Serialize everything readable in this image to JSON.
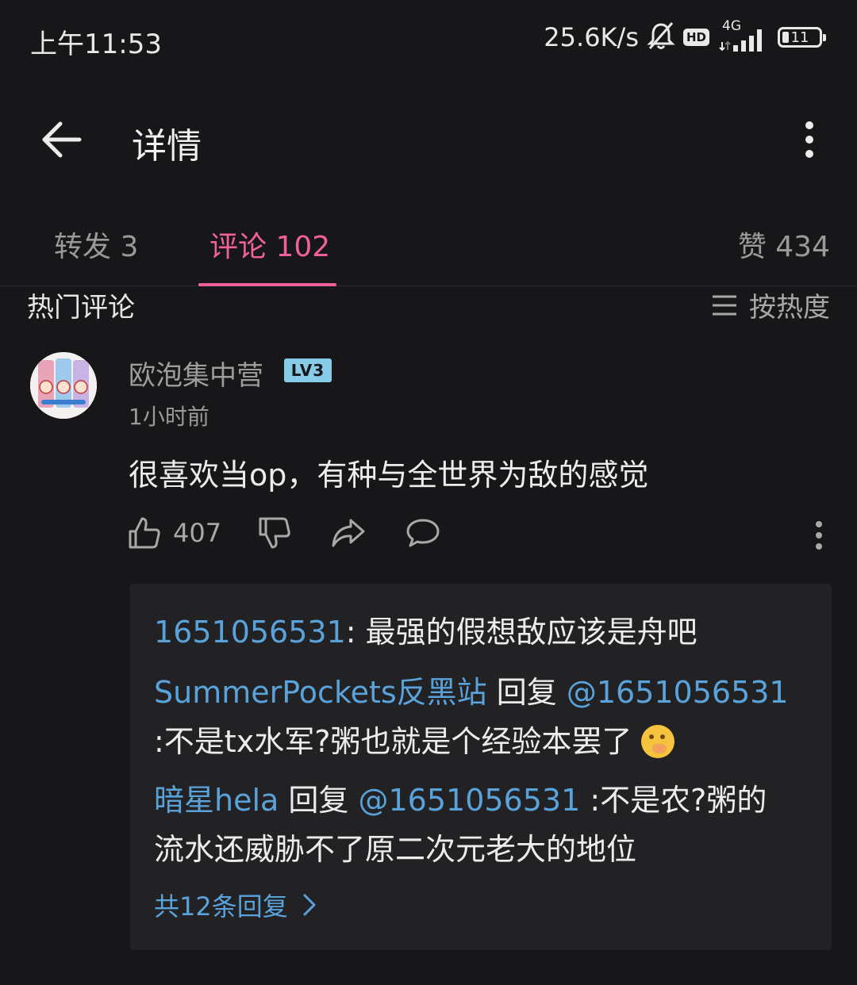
{
  "status_bar": {
    "time": "上午11:53",
    "net_speed": "25.6K/s",
    "hd": "HD",
    "network": "4G",
    "battery": "11"
  },
  "header": {
    "title": "详情"
  },
  "tabs": {
    "repost": "转发 3",
    "comment": "评论 102",
    "like": "赞 434"
  },
  "section": {
    "title": "热门评论",
    "sort_label": "按热度"
  },
  "comment": {
    "username": "欧泡集中营",
    "level": "LV3",
    "time": "1小时前",
    "text": "很喜欢当op，有种与全世界为敌的感觉",
    "likes": "407"
  },
  "replies": [
    {
      "user": "1651056531",
      "sep": ": ",
      "text": "最强的假想敌应该是舟吧"
    },
    {
      "user": "SummerPockets反黑站",
      "verb": " 回复 ",
      "target": "@1651056531",
      "text": " :不是tx水军?粥也就是个经验本罢了"
    },
    {
      "user": "暗星hela",
      "verb": " 回复 ",
      "target": "@1651056531",
      "text": " :不是农?粥的流水还威胁不了原二次元老大的地位"
    }
  ],
  "more_replies": "共12条回复",
  "colors": {
    "accent": "#f0609a",
    "link": "#5aa3da",
    "background": "#17171a"
  }
}
